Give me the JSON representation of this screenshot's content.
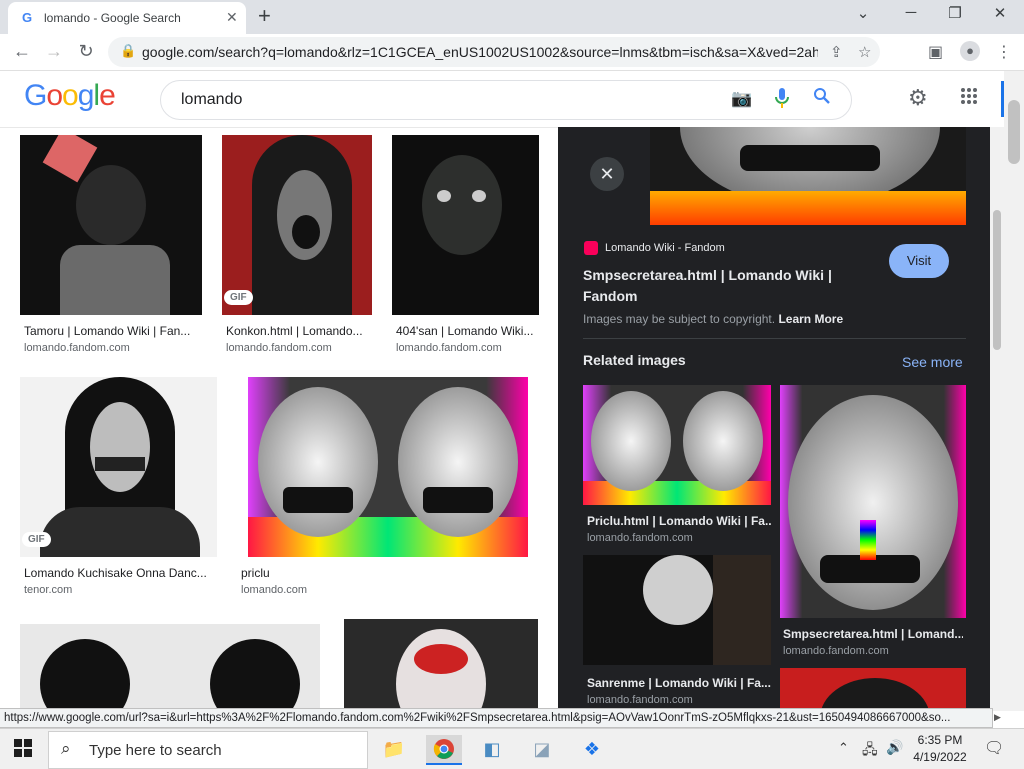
{
  "browser": {
    "tab_title": "lomando - Google Search",
    "tab_favicon": "G",
    "url": "google.com/search?q=lomando&rlz=1C1GCEA_enUS1002US1002&source=lnms&tbm=isch&sa=X&ved=2ahUK...",
    "icons": [
      "back-icon",
      "forward-icon",
      "reload-icon",
      "lock-icon",
      "share-icon",
      "star-icon",
      "sidebar-icon",
      "profile-icon",
      "menu-icon"
    ]
  },
  "google": {
    "logo": "Google",
    "query": "lomando"
  },
  "results": [
    {
      "caption": "Tamoru | Lomando Wiki | Fan...",
      "source": "lomando.fandom.com",
      "badge": ""
    },
    {
      "caption": "Konkon.html | Lomando...",
      "source": "lomando.fandom.com",
      "badge": "GIF"
    },
    {
      "caption": "404'san | Lomando Wiki...",
      "source": "lomando.fandom.com",
      "badge": ""
    },
    {
      "caption": "Lomando Kuchisake Onna Danc...",
      "source": "tenor.com",
      "badge": "GIF"
    },
    {
      "caption": "priclu",
      "source": "lomando.com",
      "badge": ""
    }
  ],
  "panel": {
    "site": "Lomando Wiki - Fandom",
    "title_line1": "Smpsecretarea.html | Lomando Wiki |",
    "title_line2": "Fandom",
    "visit_label": "Visit",
    "copyright": "Images may be subject to copyright.",
    "learn_more": "Learn More",
    "related_heading": "Related images",
    "see_more": "See more",
    "related": [
      {
        "caption": "Priclu.html | Lomando Wiki | Fa...",
        "source": "lomando.fandom.com"
      },
      {
        "caption": "Smpsecretarea.html | Lomand...",
        "source": "lomando.fandom.com"
      },
      {
        "caption": "Sanrenme | Lomando Wiki | Fa...",
        "source": "lomando.fandom.com"
      }
    ]
  },
  "status_url": "https://www.google.com/url?sa=i&url=https%3A%2F%2Flomando.fandom.com%2Fwiki%2FSmpsecretarea.html&psig=AOvVaw1OonrTmS-zO5Mflqkxs-21&ust=1650494086667000&so...",
  "taskbar": {
    "search_placeholder": "Type here to search",
    "time": "6:35 PM",
    "date": "4/19/2022"
  },
  "colors": {
    "accent": "#1a73e8",
    "panel_bg": "#202124",
    "visit_bg": "#8ab4f8"
  }
}
